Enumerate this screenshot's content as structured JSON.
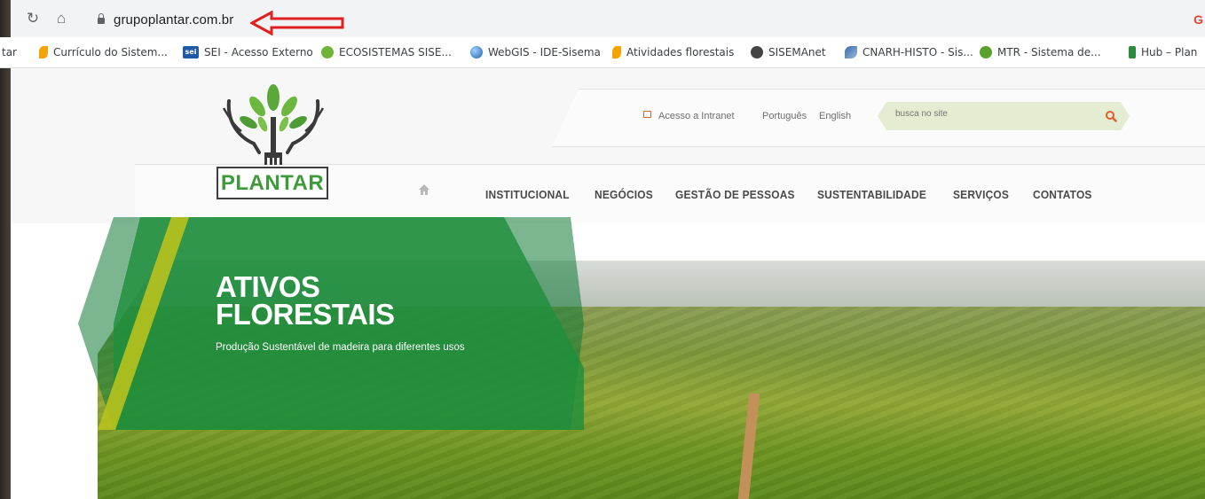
{
  "browser": {
    "url": "grupoplantar.com.br",
    "bookmarks": [
      {
        "label": "tar",
        "icon": "bookmark-fragment-icon",
        "color": "#8a8a8a"
      },
      {
        "label": "Currículo do Sistem...",
        "icon": "cv-icon",
        "color": "#f4a300"
      },
      {
        "label": "SEI - Acesso Externo",
        "icon": "sei-icon",
        "color": "#1e5aa8"
      },
      {
        "label": "ECOSISTEMAS SISE...",
        "icon": "eco-icon",
        "color": "#6fb33a"
      },
      {
        "label": "WebGIS - IDE-Sisema",
        "icon": "globe-icon",
        "color": "#1f78c8"
      },
      {
        "label": "Atividades florestais",
        "icon": "forest-icon",
        "color": "#f4a300"
      },
      {
        "label": "SISEMAnet",
        "icon": "sisema-icon",
        "color": "#444444"
      },
      {
        "label": "CNARH-HISTO - Sis...",
        "icon": "water-icon",
        "color": "#3a6aa8"
      },
      {
        "label": "MTR - Sistema de...",
        "icon": "recycle-icon",
        "color": "#5aa02c"
      },
      {
        "label": "Hub – Plan",
        "icon": "flag-icon",
        "color": "#2e8b3c"
      }
    ]
  },
  "site": {
    "logo_text": "PLANTAR",
    "util": {
      "intranet": "Acesso a Intranet",
      "lang_pt": "Português",
      "lang_en": "English",
      "search_placeholder": "busca no site"
    },
    "menu": [
      "INSTITUCIONAL",
      "NEGÓCIOS",
      "GESTÃO DE PESSOAS",
      "SUSTENTABILIDADE",
      "SERVIÇOS",
      "CONTATOS"
    ],
    "banner": {
      "title_line1": "ATIVOS",
      "title_line2": "FLORESTAIS",
      "subtitle": "Produção Sustentável de madeira para diferentes usos"
    }
  },
  "colors": {
    "brand_green": "#3d9b3a",
    "panel_green": "#1f8f3c",
    "accent_orange": "#e06030",
    "arrow_red": "#e02020"
  }
}
